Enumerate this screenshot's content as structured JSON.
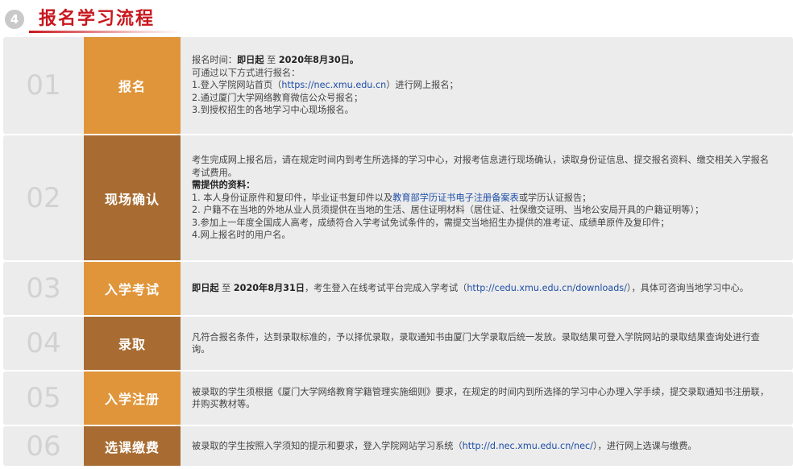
{
  "header": {
    "step_number": "4",
    "title": "报名学习流程"
  },
  "rows": [
    {
      "num": "01",
      "label": "报名",
      "lines": [
        [
          {
            "t": "报名时间："
          },
          {
            "t": "即日起",
            "b": true
          },
          {
            "t": " 至 "
          },
          {
            "t": "2020年8月30日。",
            "b": true
          }
        ],
        [
          {
            "t": "可通过以下方式进行报名："
          }
        ],
        [
          {
            "t": "1.登入学院网站首页（"
          },
          {
            "t": "https://nec.xmu.edu.cn",
            "link": true
          },
          {
            "t": "）进行网上报名；"
          }
        ],
        [
          {
            "t": "2.通过厦门大学网络教育微信公众号报名；"
          }
        ],
        [
          {
            "t": "3.到授权招生的各地学习中心现场报名。"
          }
        ]
      ]
    },
    {
      "num": "02",
      "label": "现场确认",
      "lines": [
        [
          {
            "t": "考生完成网上报名后，请在规定时间内到考生所选择的学习中心，对报考信息进行现场确认，读取身份证信息、提交报名资料、缴交相关入学报名考试费用。"
          }
        ],
        [
          {
            "t": "需提供的资料：",
            "b": true
          }
        ],
        [
          {
            "t": "1. 本人身份证原件和复印件，毕业证书复印件以及"
          },
          {
            "t": "教育部学历证书电子注册备案表",
            "link": true
          },
          {
            "t": "或学历认证报告；"
          }
        ],
        [
          {
            "t": "2. 户籍不在当地的外地从业人员须提供在当地的生活、居住证明材料（居住证、社保缴交证明、当地公安局开具的户籍证明等）；"
          }
        ],
        [
          {
            "t": "3.参加上一年度全国成人高考，成绩符合入学考试免试条件的，需提交当地招生办提供的准考证、成绩单原件及复印件；"
          }
        ],
        [
          {
            "t": "4.网上报名时的用户名。"
          }
        ]
      ]
    },
    {
      "num": "03",
      "label": "入学考试",
      "lines": [
        [
          {
            "t": "即日起",
            "b": true
          },
          {
            "t": " 至 "
          },
          {
            "t": "2020年8月31日",
            "b": true
          },
          {
            "t": "，考生登入在线考试平台完成入学考试（"
          },
          {
            "t": "http://cedu.xmu.edu.cn/downloads/",
            "link": true
          },
          {
            "t": "），具体可咨询当地学习中心。"
          }
        ]
      ]
    },
    {
      "num": "04",
      "label": "录取",
      "lines": [
        [
          {
            "t": "凡符合报名条件，达到录取标准的，予以择优录取，录取通知书由厦门大学录取后统一发放。录取结果可登入学院网站的录取结果查询处进行查询。"
          }
        ]
      ]
    },
    {
      "num": "05",
      "label": "入学注册",
      "lines": [
        [
          {
            "t": "被录取的学生须根据《厦门大学网络教育学籍管理实施细则》要求，在规定的时间内到所选择的学习中心办理入学手续，提交录取通知书注册联，并购买教材等。"
          }
        ]
      ]
    },
    {
      "num": "06",
      "label": "选课缴费",
      "lines": [
        [
          {
            "t": "被录取的学生按照入学须知的提示和要求，登入学院网站学习系统（"
          },
          {
            "t": "http://d.nec.xmu.edu.cn/nec/",
            "link": true
          },
          {
            "t": "），进行网上选课与缴费。"
          }
        ]
      ]
    }
  ]
}
